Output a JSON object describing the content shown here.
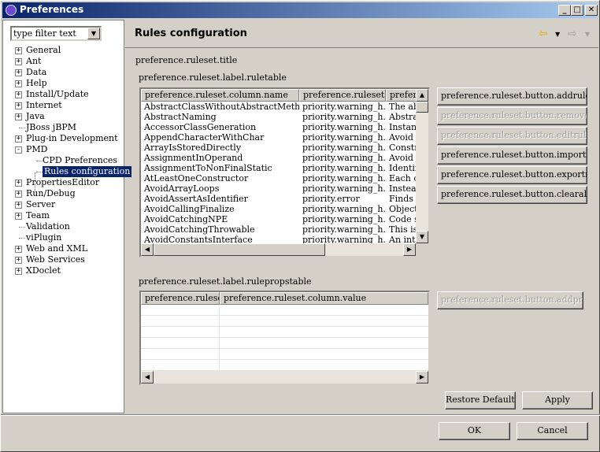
{
  "window": {
    "title": "Preferences"
  },
  "filter": {
    "value": "type filter text"
  },
  "tree": [
    {
      "label": "General",
      "toggle": "+"
    },
    {
      "label": "Ant",
      "toggle": "+"
    },
    {
      "label": "Data",
      "toggle": "+"
    },
    {
      "label": "Help",
      "toggle": "+"
    },
    {
      "label": "Install/Update",
      "toggle": "+"
    },
    {
      "label": "Internet",
      "toggle": "+"
    },
    {
      "label": "Java",
      "toggle": "+"
    },
    {
      "label": "JBoss jBPM",
      "toggle": ""
    },
    {
      "label": "Plug-in Development",
      "toggle": "+"
    },
    {
      "label": "PMD",
      "toggle": "-"
    },
    {
      "label": "CPD Preferences",
      "toggle": "",
      "child": true
    },
    {
      "label": "Rules configuration",
      "toggle": "",
      "child": true,
      "selected": true
    },
    {
      "label": "PropertiesEditor",
      "toggle": "+"
    },
    {
      "label": "Run/Debug",
      "toggle": "+"
    },
    {
      "label": "Server",
      "toggle": "+"
    },
    {
      "label": "Team",
      "toggle": "+"
    },
    {
      "label": "Validation",
      "toggle": ""
    },
    {
      "label": "viPlugin",
      "toggle": ""
    },
    {
      "label": "Web and XML",
      "toggle": "+"
    },
    {
      "label": "Web Services",
      "toggle": "+"
    },
    {
      "label": "XDoclet",
      "toggle": "+"
    }
  ],
  "page": {
    "title": "Rules configuration",
    "ruleset_title": "preference.ruleset.title",
    "ruletable_label": "preference.ruleset.label.ruletable",
    "rulepropstable_label": "preference.ruleset.label.rulepropstable"
  },
  "ruletable": {
    "columns": [
      "preference.ruleset.column.name",
      "preference.ruleset....",
      "prefere"
    ],
    "rows": [
      [
        "AbstractClassWithoutAbstractMethod",
        "priority.warning_h...",
        "The abst"
      ],
      [
        "AbstractNaming",
        "priority.warning_h...",
        "Abstrac"
      ],
      [
        "AccessorClassGeneration",
        "priority.warning_h...",
        "Instanti"
      ],
      [
        "AppendCharacterWithChar",
        "priority.warning_h...",
        "Avoid c"
      ],
      [
        "ArrayIsStoredDirectly",
        "priority.warning_h...",
        "Constru"
      ],
      [
        "AssignmentInOperand",
        "priority.warning_h...",
        "Avoid a"
      ],
      [
        "AssignmentToNonFinalStatic",
        "priority.warning_h...",
        "Identifi"
      ],
      [
        "AtLeastOneConstructor",
        "priority.warning_h...",
        "Each cl"
      ],
      [
        "AvoidArrayLoops",
        "priority.warning_h...",
        "Instead"
      ],
      [
        "AvoidAssertAsIdentifier",
        "priority.error",
        "Finds a"
      ],
      [
        "AvoidCallingFinalize",
        "priority.warning_h...",
        "Object.:"
      ],
      [
        "AvoidCatchingNPE",
        "priority.warning_h...",
        "Code sh"
      ],
      [
        "AvoidCatchingThrowable",
        "priority.warning_h...",
        "This is c"
      ],
      [
        "AvoidConstantsInterface",
        "priority.warning_h...",
        "An inte"
      ]
    ]
  },
  "rule_buttons": {
    "addrule": "preference.ruleset.button.addrule",
    "removerule": "preference.ruleset.button.removerule",
    "editrule": "preference.ruleset.button.editrule",
    "importruleset": "preference.ruleset.button.importruleset",
    "exportruleset": "preference.ruleset.button.exportruleset",
    "clearall": "preference.ruleset.button.clearall"
  },
  "proptable": {
    "columns": [
      "preference.rulese...",
      "preference.ruleset.column.value"
    ],
    "empty_rows": 6
  },
  "addproperty_button": "preference.ruleset.button.addproperty",
  "buttons": {
    "restore_defaults": "Restore Defaults",
    "apply": "Apply",
    "ok": "OK",
    "cancel": "Cancel"
  },
  "colors": {
    "selection": "#0a246a",
    "titlebar": "#0a246a",
    "face": "#d4d0c8"
  }
}
